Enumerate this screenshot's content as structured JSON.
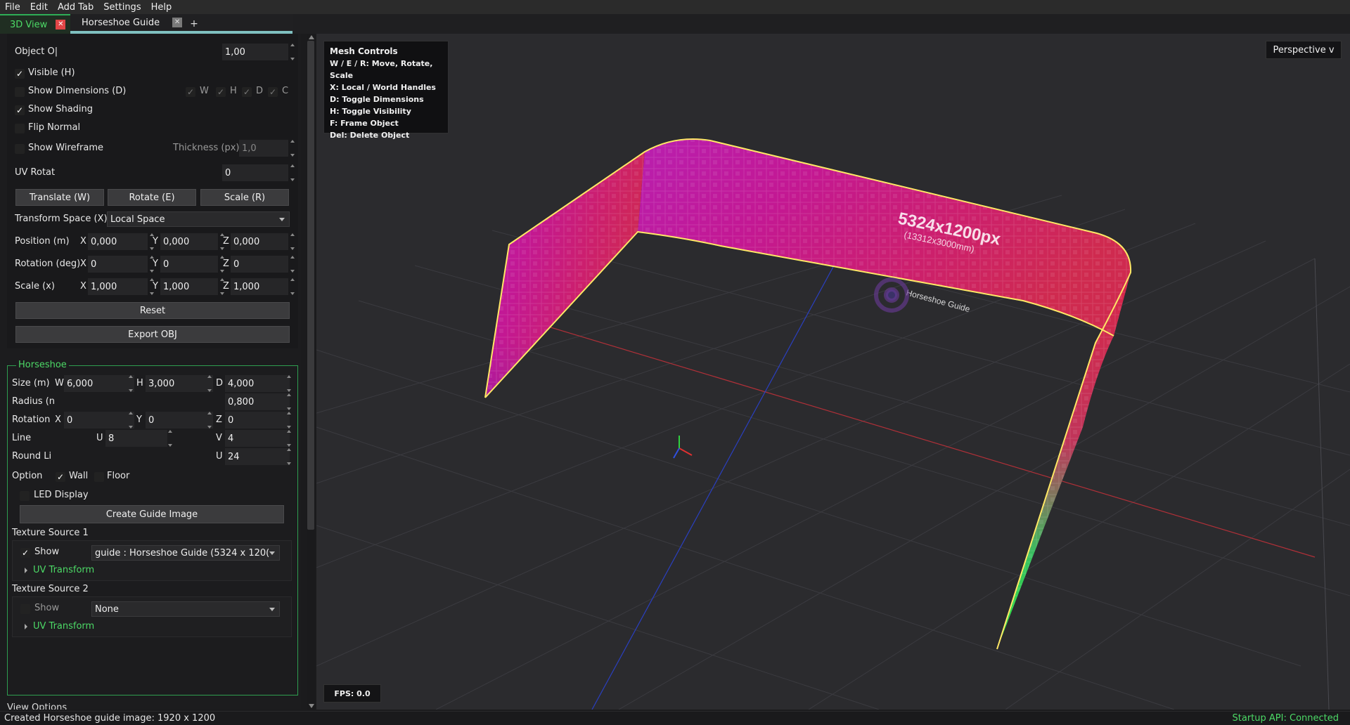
{
  "menu": [
    "File",
    "Edit",
    "Add Tab",
    "Settings",
    "Help"
  ],
  "tabs": [
    {
      "label": "3D View",
      "close": "✕"
    },
    {
      "label": "Horseshoe Guide",
      "close": "✕"
    }
  ],
  "tab_add": "+",
  "object": {
    "opacity_label": "Object O|",
    "opacity_value": "1,00",
    "visible_label": "Visible (H)",
    "show_dimensions_label": "Show Dimensions (D)",
    "dim_w": "W",
    "dim_h": "H",
    "dim_d": "D",
    "dim_c": "C",
    "show_shading_label": "Show Shading",
    "flip_normal_label": "Flip Normal",
    "show_wireframe_label": "Show Wireframe",
    "thickness_label": "Thickness (px)",
    "thickness_value": "1,0",
    "uv_rotate_label": "UV Rotat",
    "uv_rotate_value": "0",
    "translate_btn": "Translate (W)",
    "rotate_btn": "Rotate (E)",
    "scale_btn": "Scale (R)",
    "transform_space_label": "Transform Space (X)",
    "transform_space_value": "Local Space",
    "position_label": "Position (m)",
    "rotation_label": "Rotation (deg)",
    "scale_label": "Scale (x)",
    "axis_x": "X",
    "axis_y": "Y",
    "axis_z": "Z",
    "position": [
      "0,000",
      "0,000",
      "0,000"
    ],
    "rotation": [
      "0",
      "0",
      "0"
    ],
    "scale": [
      "1,000",
      "1,000",
      "1,000"
    ],
    "reset_btn": "Reset",
    "export_btn": "Export OBJ"
  },
  "horseshoe": {
    "title": "Horseshoe",
    "size_label": "Size (m)",
    "w_label": "W",
    "w_value": "6,000",
    "h_label": "H",
    "h_value": "3,000",
    "d_label": "D",
    "d_value": "4,000",
    "radius_label": "Radius (n",
    "radius_value": "0,800",
    "rotation_label": "Rotation",
    "rot_x_label": "X",
    "rot_x": "0",
    "rot_y_label": "Y",
    "rot_y": "0",
    "rot_z_label": "Z",
    "rot_z": "0",
    "line_label": "Line",
    "line_u_label": "U",
    "line_u": "8",
    "line_v_label": "V",
    "line_v": "4",
    "round_label": "Round Li",
    "round_u_label": "U",
    "round_u": "24",
    "option_label": "Option",
    "wall_label": "Wall",
    "floor_label": "Floor",
    "led_label": "LED Display",
    "create_btn": "Create Guide Image",
    "tex1_title": "Texture Source 1",
    "tex1_show": "Show",
    "tex1_source": "guide : Horseshoe Guide (5324 x 120(",
    "uv_transform": "UV Transform",
    "tex2_title": "Texture Source 2",
    "tex2_show": "Show",
    "tex2_source": "None"
  },
  "view_options": "View Options",
  "viewport": {
    "mesh_controls_title": "Mesh Controls",
    "mesh_controls": [
      "W / E / R: Move, Rotate, Scale",
      "X: Local / World Handles",
      "D: Toggle Dimensions",
      "H: Toggle Visibility",
      "F: Frame Object",
      "Del: Delete Object"
    ],
    "projection": "Perspective v",
    "fps": "FPS: 0.0",
    "texture_size": "5324x1200px",
    "texture_mm": "(13312x3000mm)",
    "texture_name": "Horseshoe Guide"
  },
  "status": {
    "message": "Created Horseshoe guide image: 1920 x 1200",
    "api": "Startup API: Connected"
  },
  "colors": {
    "accent_green": "#4cd966",
    "close_red": "#e04646",
    "tab_underline": "#7fc0c0",
    "mesh_outline": "#ffe866"
  }
}
